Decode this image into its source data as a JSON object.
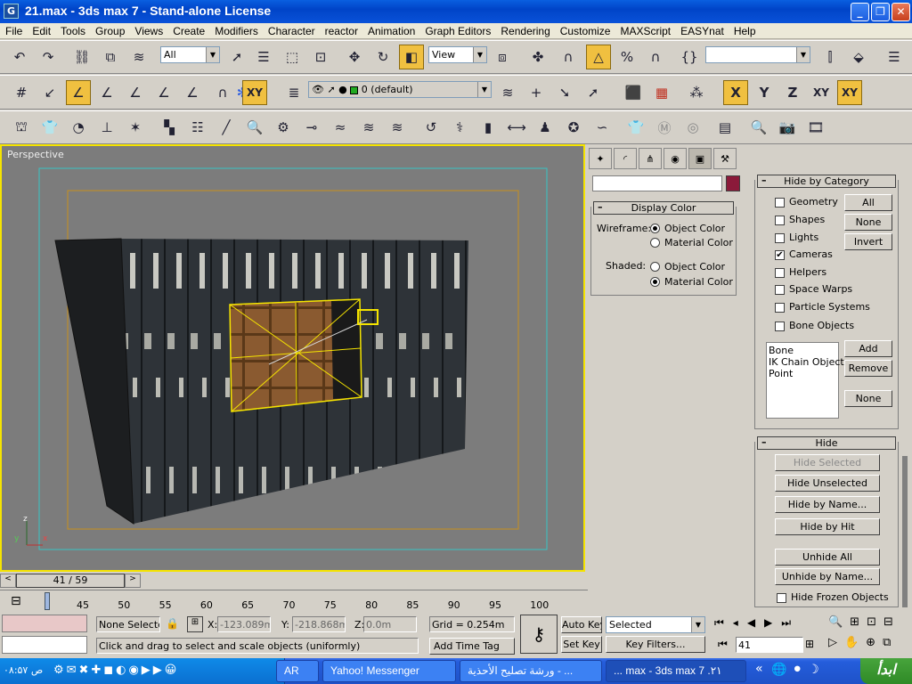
{
  "window": {
    "title": "21.max - 3ds max 7 - Stand-alone License",
    "app_icon": "3ds-max-icon"
  },
  "menu": [
    "File",
    "Edit",
    "Tools",
    "Group",
    "Views",
    "Create",
    "Modifiers",
    "Character",
    "reactor",
    "Animation",
    "Graph Editors",
    "Rendering",
    "Customize",
    "MAXScript",
    "EASYnat",
    "Help"
  ],
  "toolbar": {
    "selection_filter": "All",
    "ref_coord": "View",
    "named_selection": "",
    "layer": "0 (default)",
    "axis_x": "X",
    "axis_y": "Y",
    "axis_z": "Z",
    "axis_xy": "XY",
    "axis_xy2": "XY"
  },
  "viewport": {
    "label": "Perspective",
    "axes": {
      "z": "z",
      "y": "y",
      "x": "x"
    }
  },
  "command_panel": {
    "name_field": "",
    "color_swatch": "#8b1a3a",
    "display_color": {
      "title": "Display Color",
      "wireframe_label": "Wireframe:",
      "shaded_label": "Shaded:",
      "object_color": "Object Color",
      "material_color": "Material Color",
      "wireframe_selected": "Object Color",
      "shaded_selected": "Material Color"
    },
    "hide_by_category": {
      "title": "Hide by Category",
      "items": [
        {
          "label": "Geometry",
          "checked": false
        },
        {
          "label": "Shapes",
          "checked": false
        },
        {
          "label": "Lights",
          "checked": false
        },
        {
          "label": "Cameras",
          "checked": true
        },
        {
          "label": "Helpers",
          "checked": false
        },
        {
          "label": "Space Warps",
          "checked": false
        },
        {
          "label": "Particle Systems",
          "checked": false
        },
        {
          "label": "Bone Objects",
          "checked": false
        }
      ],
      "btn_all": "All",
      "btn_none": "None",
      "btn_invert": "Invert",
      "list": [
        "Bone",
        "IK Chain Object",
        "Point"
      ],
      "btn_add": "Add",
      "btn_remove": "Remove",
      "btn_none2": "None"
    },
    "hide": {
      "title": "Hide",
      "hide_selected": "Hide Selected",
      "hide_unselected": "Hide Unselected",
      "hide_by_name": "Hide by Name...",
      "hide_by_hit": "Hide by Hit",
      "unhide_all": "Unhide All",
      "unhide_by_name": "Unhide by Name...",
      "hide_frozen": "Hide Frozen Objects"
    }
  },
  "timeline": {
    "slider": "41 / 59",
    "ticks": [
      "45",
      "50",
      "55",
      "60",
      "65",
      "70",
      "75",
      "80",
      "85",
      "90",
      "95",
      "100"
    ]
  },
  "status": {
    "selection": "None Selecte",
    "x_label": "X:",
    "x_value": "-123.089m",
    "y_label": "Y:",
    "y_value": "-218.868m",
    "z_label": "Z:",
    "z_value": "0.0m",
    "grid": "Grid = 0.254m",
    "prompt": "Click and drag to select and scale objects (uniformly)",
    "add_time_tag": "Add Time Tag",
    "auto_key": "Auto Key",
    "set_key": "Set Key",
    "key_mode": "Selected",
    "key_filters": "Key Filters...",
    "frame": "41"
  },
  "taskbar": {
    "start": "ابدأ",
    "clock": "۰۸:۵۷ ص",
    "tasks": [
      {
        "label": "AR",
        "active": false
      },
      {
        "label": "Yahoo! Messenger",
        "active": false
      },
      {
        "label": "ورشة تصليح الأحذية - ...",
        "active": false
      },
      {
        "label": "... max - 3ds max 7 .۲۱",
        "active": true
      }
    ]
  }
}
